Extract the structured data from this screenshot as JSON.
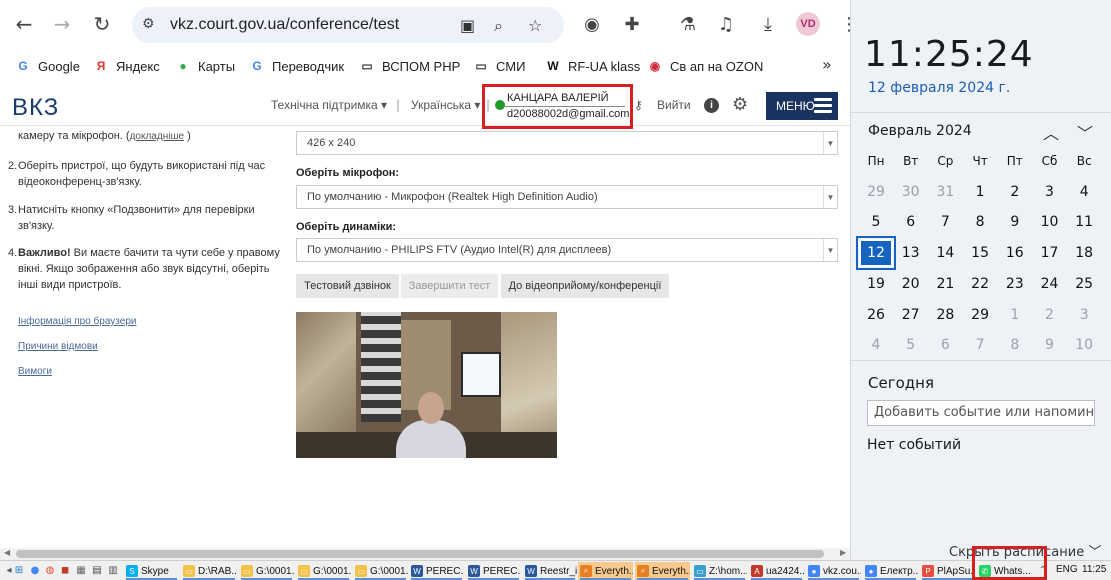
{
  "browser": {
    "url": "vkz.court.gov.ua/conference/test",
    "avatar_initials": "VD",
    "bookmarks": [
      {
        "label": "Google",
        "icon": "google-icon",
        "glyph": "G",
        "color": "#4285f4"
      },
      {
        "label": "Яндекс",
        "icon": "yandex-icon",
        "glyph": "Я",
        "color": "#e33a2c"
      },
      {
        "label": "Карты",
        "icon": "maps-pin-icon",
        "glyph": "●",
        "color": "#34a853"
      },
      {
        "label": "Переводчик",
        "icon": "translate-icon",
        "glyph": "G",
        "color": "#4285f4"
      },
      {
        "label": "ВСПОМ PHP",
        "icon": "folder-icon",
        "glyph": "▭",
        "color": "#444444"
      },
      {
        "label": "СМИ",
        "icon": "folder-icon",
        "glyph": "▭",
        "color": "#444444"
      },
      {
        "label": "RF-UA klass",
        "icon": "wix-icon",
        "glyph": "W",
        "color": "#111111"
      },
      {
        "label": "Св ап на OZON",
        "icon": "ozon-icon",
        "glyph": "◉",
        "color": "#d22b3c"
      }
    ],
    "more": "»"
  },
  "site": {
    "logo": "ВКЗ",
    "support": "Технічна підтримка ▾",
    "language": "Українська ▾",
    "user_name": "КАНЦАРА ВАЛЕРІЙ",
    "user_email": "d20088002d@gmail.com",
    "logout": "Вийти",
    "menu": "МЕНЮ"
  },
  "instructions": {
    "item1_tail": "камеру та мікрофон. (",
    "item1_link": "докладніше",
    "item1_close": ")",
    "item2_num": "2.",
    "item2": "Оберіть пристрої, що будуть використані під час відеоконференц-зв'язку.",
    "item3_num": "3.",
    "item3": "Натисніть кнопку «Подзвонити» для перевірки зв'язку.",
    "item4_num": "4.",
    "item4_bold": "Важливо!",
    "item4": " Ви маєте бачити та чути себе у правому вікні. Якщо зображення або звук відсутні, оберіть інші види пристроїв.",
    "links": [
      "Інформація про браузери",
      "Причини відмови",
      "Вимоги"
    ]
  },
  "form": {
    "resolution": "426 x 240",
    "mic_label": "Оберіть мікрофон:",
    "mic_value": "По умолчанию - Микрофон (Realtek High Definition Audio)",
    "speaker_label": "Оберіть динаміки:",
    "speaker_value": "По умолчанию - PHILIPS FTV (Аудио Intel(R) для дисплеев)",
    "btn_test": "Тестовий дзвінок",
    "btn_end": "Завершити тест",
    "btn_join": "До відеоприйому/конференції"
  },
  "clock": {
    "time": "11:25:24",
    "date": "12 февраля 2024 г.",
    "month": "Февраль 2024",
    "weekdays": [
      "Пн",
      "Вт",
      "Ср",
      "Чт",
      "Пт",
      "Сб",
      "Вс"
    ],
    "weeks": [
      [
        "29",
        "30",
        "31",
        "1",
        "2",
        "3",
        "4"
      ],
      [
        "5",
        "6",
        "7",
        "8",
        "9",
        "10",
        "11"
      ],
      [
        "12",
        "13",
        "14",
        "15",
        "16",
        "17",
        "18"
      ],
      [
        "19",
        "20",
        "21",
        "22",
        "23",
        "24",
        "25"
      ],
      [
        "26",
        "27",
        "28",
        "29",
        "1",
        "2",
        "3"
      ],
      [
        "4",
        "5",
        "6",
        "7",
        "8",
        "9",
        "10"
      ]
    ],
    "muted_prefix": 3,
    "muted_suffix_from": 4,
    "muted_week_index": 4,
    "today": "12",
    "today_title": "Сегодня",
    "event_placeholder": "Добавить событие или напоминание",
    "no_events": "Нет событий",
    "hide_schedule": "Скрыть расписание"
  },
  "taskbar": {
    "items": [
      {
        "label": "Skype",
        "color": "#00aff0",
        "glyph": "S"
      },
      {
        "label": "D:\\RAB...",
        "color": "#f3c24b",
        "glyph": "▭"
      },
      {
        "label": "G:\\0001...",
        "color": "#f3c24b",
        "glyph": "▭"
      },
      {
        "label": "G:\\0001...",
        "color": "#f3c24b",
        "glyph": "▭"
      },
      {
        "label": "G:\\0001...",
        "color": "#f3c24b",
        "glyph": "▭"
      },
      {
        "label": "PEREC...",
        "color": "#2b579a",
        "glyph": "W"
      },
      {
        "label": "PEREC...",
        "color": "#2b579a",
        "glyph": "W"
      },
      {
        "label": "Reestr_i...",
        "color": "#2b579a",
        "glyph": "W"
      },
      {
        "label": "Everyth...",
        "color": "#e67e22",
        "glyph": "⌕"
      },
      {
        "label": "Everyth...",
        "color": "#e67e22",
        "glyph": "⌕"
      },
      {
        "label": "Z:\\hom...",
        "color": "#3aa0c8",
        "glyph": "▭"
      },
      {
        "label": "ua2424...",
        "color": "#c0392b",
        "glyph": "A"
      },
      {
        "label": "vkz.cou...",
        "color": "#4285f4",
        "glyph": "●"
      },
      {
        "label": "Електр...",
        "color": "#4285f4",
        "glyph": "●"
      },
      {
        "label": "PlApSu...",
        "color": "#e74c3c",
        "glyph": "P"
      },
      {
        "label": "Whats...",
        "color": "#25d366",
        "glyph": "✆"
      }
    ],
    "lang": "ENG",
    "time": "11:25"
  }
}
